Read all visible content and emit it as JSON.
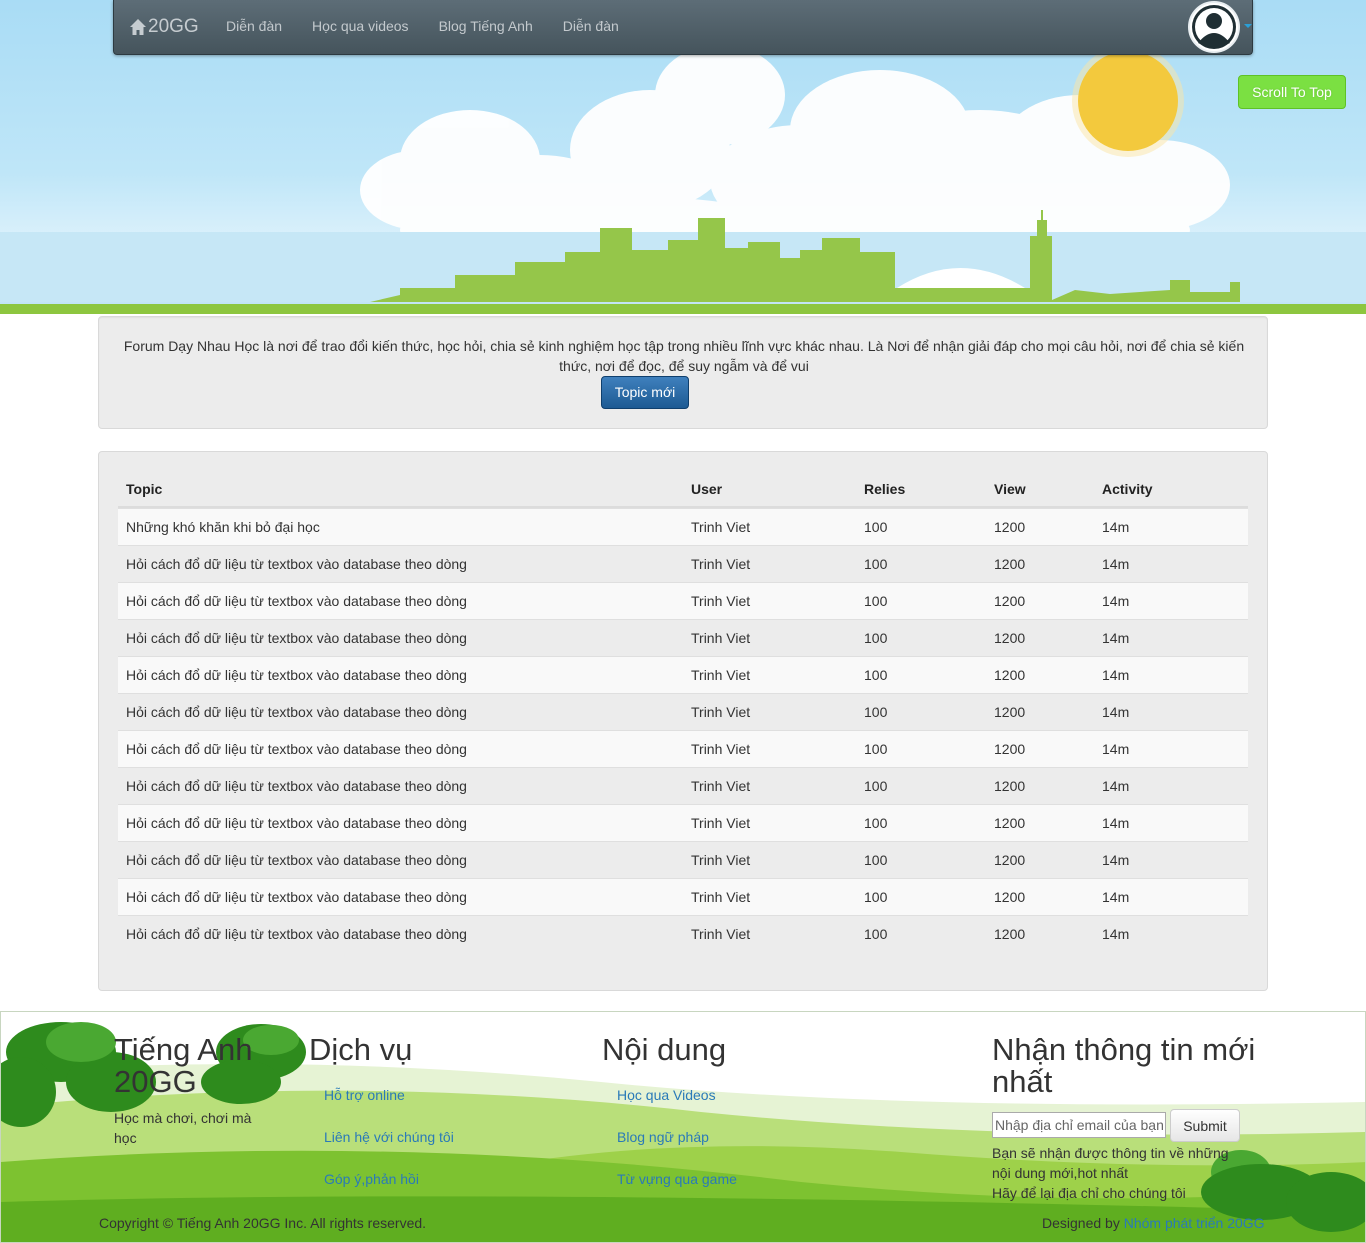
{
  "navbar": {
    "brand": "20GG",
    "links": [
      "Diễn đàn",
      "Học qua videos",
      "Blog Tiếng Anh",
      "Diễn đàn"
    ]
  },
  "scroll_top_label": "Scroll To Top",
  "intro": {
    "text": "Forum Dạy Nhau Học là nơi để trao đổi kiến thức, học hỏi, chia sẻ kinh nghiệm học tập trong nhiều lĩnh vực khác nhau. Là Nơi để nhận giải đáp cho mọi câu hỏi, nơi để chia sẻ kiến thức, nơi để đọc, để suy ngẫm và để vui",
    "button_label": "Topic mới"
  },
  "table": {
    "headers": [
      "Topic",
      "User",
      "Relies",
      "View",
      "Activity"
    ],
    "rows": [
      [
        "Những khó khăn khi bỏ đại học",
        "Trinh Viet",
        "100",
        "1200",
        "14m"
      ],
      [
        "Hỏi cách đổ dữ liệu từ textbox vào database theo dòng",
        "Trinh Viet",
        "100",
        "1200",
        "14m"
      ],
      [
        "Hỏi cách đổ dữ liệu từ textbox vào database theo dòng",
        "Trinh Viet",
        "100",
        "1200",
        "14m"
      ],
      [
        "Hỏi cách đổ dữ liệu từ textbox vào database theo dòng",
        "Trinh Viet",
        "100",
        "1200",
        "14m"
      ],
      [
        "Hỏi cách đổ dữ liệu từ textbox vào database theo dòng",
        "Trinh Viet",
        "100",
        "1200",
        "14m"
      ],
      [
        "Hỏi cách đổ dữ liệu từ textbox vào database theo dòng",
        "Trinh Viet",
        "100",
        "1200",
        "14m"
      ],
      [
        "Hỏi cách đổ dữ liệu từ textbox vào database theo dòng",
        "Trinh Viet",
        "100",
        "1200",
        "14m"
      ],
      [
        "Hỏi cách đổ dữ liệu từ textbox vào database theo dòng",
        "Trinh Viet",
        "100",
        "1200",
        "14m"
      ],
      [
        "Hỏi cách đổ dữ liệu từ textbox vào database theo dòng",
        "Trinh Viet",
        "100",
        "1200",
        "14m"
      ],
      [
        "Hỏi cách đổ dữ liệu từ textbox vào database theo dòng",
        "Trinh Viet",
        "100",
        "1200",
        "14m"
      ],
      [
        "Hỏi cách đổ dữ liệu từ textbox vào database theo dòng",
        "Trinh Viet",
        "100",
        "1200",
        "14m"
      ],
      [
        "Hỏi cách đổ dữ liệu từ textbox vào database theo dòng",
        "Trinh Viet",
        "100",
        "1200",
        "14m"
      ]
    ]
  },
  "footer": {
    "about": {
      "title": "Tiếng Anh 20GG",
      "tagline": "Học mà chơi, chơi mà học"
    },
    "services": {
      "title": "Dịch vụ",
      "links": [
        "Hỗ trợ online",
        "Liên hệ với chúng tôi",
        "Góp ý,phản hồi"
      ]
    },
    "content": {
      "title": "Nội dung",
      "links": [
        "Học qua Videos",
        "Blog ngữ pháp",
        "Từ vựng qua game"
      ]
    },
    "newsletter": {
      "title": "Nhận thông tin mới nhất",
      "placeholder": "Nhập địa chỉ email của bạn",
      "submit_label": "Submit",
      "note1": "Bạn sẽ nhận được thông tin về những nội dung mới,hot nhất",
      "note2": "Hãy để lại địa chỉ cho chúng tôi"
    },
    "copyright": "Copyright © Tiếng Anh 20GG Inc. All rights reserved.",
    "designed_by_prefix": "Designed by ",
    "designed_by_link": "Nhóm phát triển 20GG"
  },
  "colors": {
    "sky": "#a9dcf5",
    "grass": "#8dc63f",
    "sun": "#f3c93d",
    "navbar": "#4f5e66",
    "primary_button": "#2b6aa5",
    "scroll_button": "#7be042",
    "link": "#2a7ab8"
  }
}
